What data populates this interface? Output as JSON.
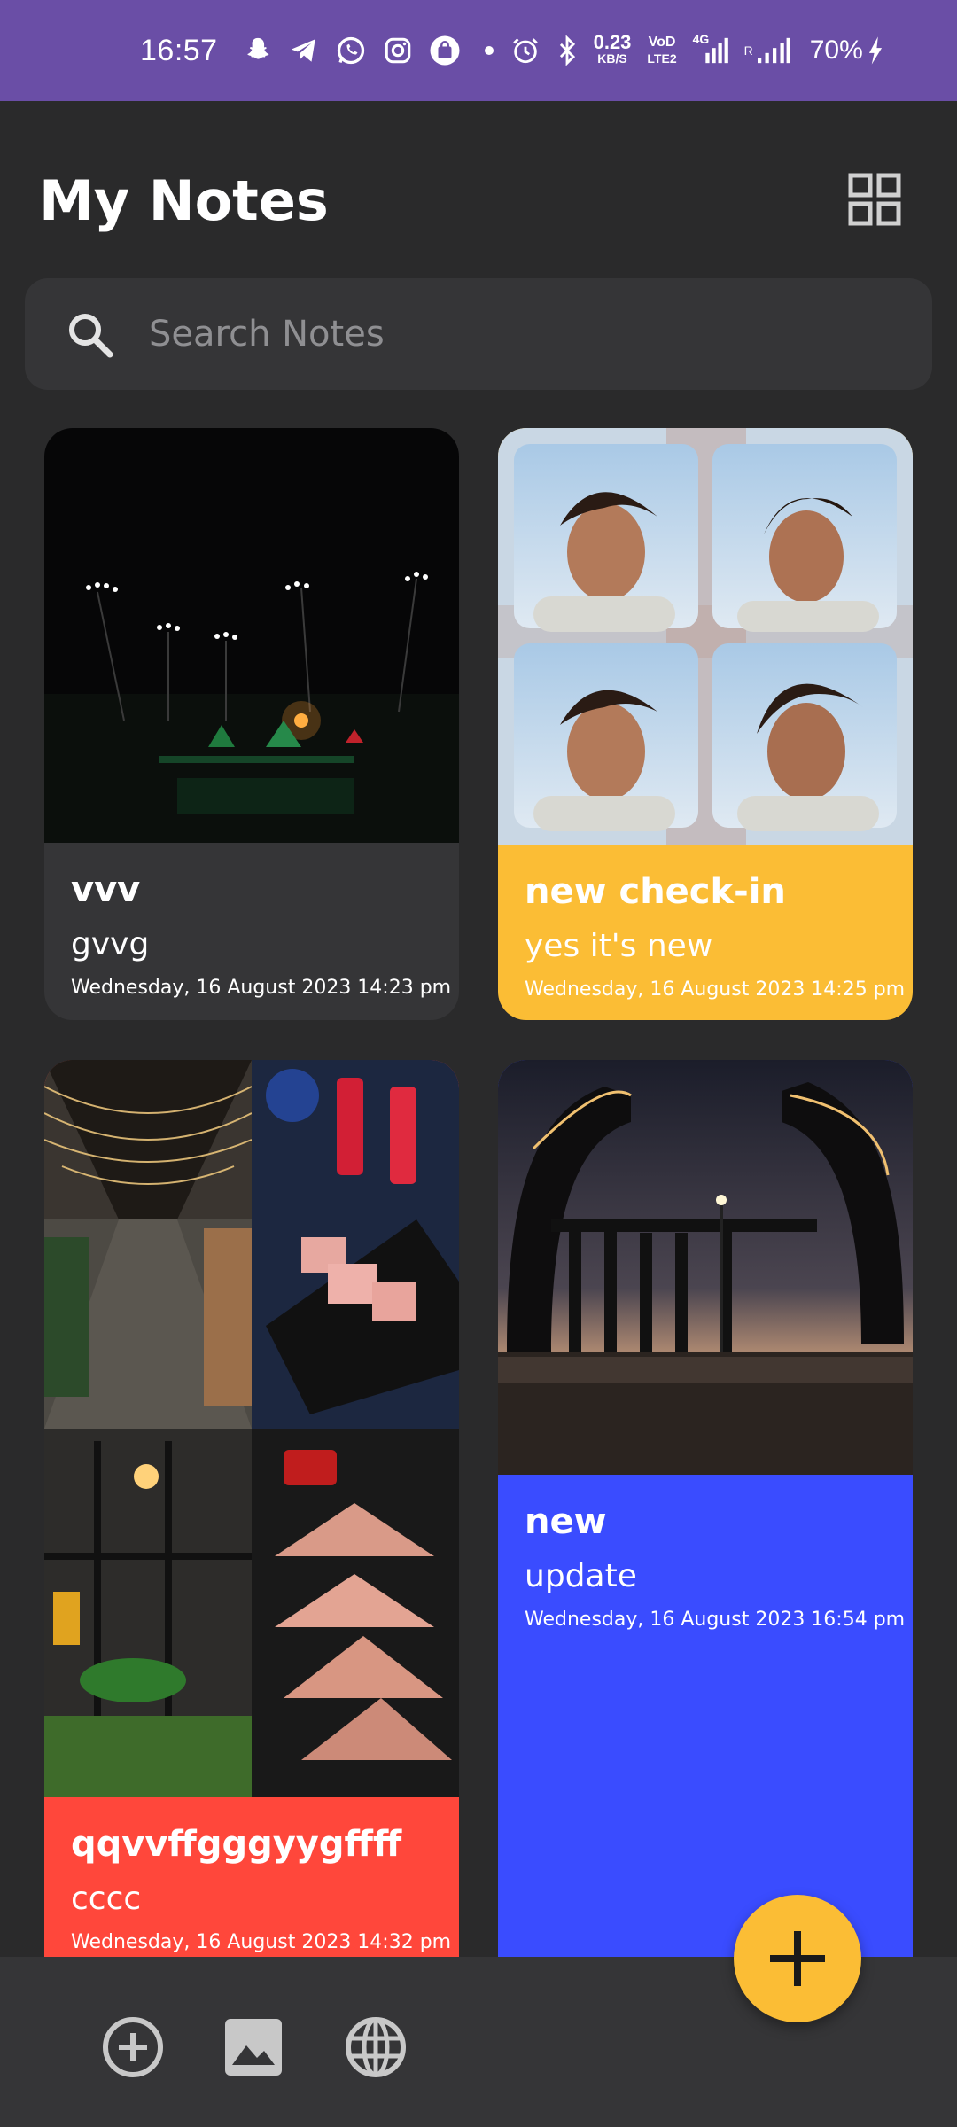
{
  "status_bar": {
    "time": "16:57",
    "net_speed_value": "0.23",
    "net_speed_unit": "KB/S",
    "volte_top": "VoD",
    "volte_bottom": "LTE2",
    "network_type": "4G",
    "roaming": "R",
    "battery": "70%",
    "icons": [
      "snapchat-icon",
      "telegram-icon",
      "whatsapp-icon",
      "instagram-icon",
      "shopping-bag-icon",
      "dot-icon",
      "alarm-icon",
      "bluetooth-icon",
      "signal-icon",
      "charging-icon"
    ]
  },
  "header": {
    "title": "My Notes",
    "layout_toggle_icon": "grid-view-icon"
  },
  "search": {
    "placeholder": "Search Notes",
    "value": ""
  },
  "notes": [
    {
      "title": "vvv",
      "subtitle": "gvvg",
      "date": "Wednesday, 16 August 2023 14:23 pm",
      "color": "#353537",
      "image": "night fountain photo"
    },
    {
      "title": "new check-in",
      "subtitle": "yes it's new",
      "date": "Wednesday, 16 August 2023 14:25 pm",
      "color": "#fbbd35",
      "image": "four portrait collage"
    },
    {
      "title": "qqvvffgggyygffff",
      "subtitle": "cccc",
      "date": "Wednesday, 16 August 2023 14:32 pm",
      "color": "#ff473b",
      "image": "cafe collage"
    },
    {
      "title": "new",
      "subtitle": "update",
      "date": "Wednesday, 16 August 2023 16:54 pm",
      "color": "#3a4cff",
      "image": "monument silhouette"
    }
  ],
  "bottom_bar": {
    "icons": [
      "add-circle-icon",
      "image-icon",
      "globe-icon"
    ]
  },
  "fab": {
    "icon": "plus-icon",
    "color": "#fbbd35"
  },
  "colors": {
    "status_bar": "#6a4ea6",
    "background": "#2a2a2b",
    "surface": "#353537",
    "accent_yellow": "#fbbd35",
    "accent_red": "#ff473b",
    "accent_blue": "#3a4cff"
  }
}
